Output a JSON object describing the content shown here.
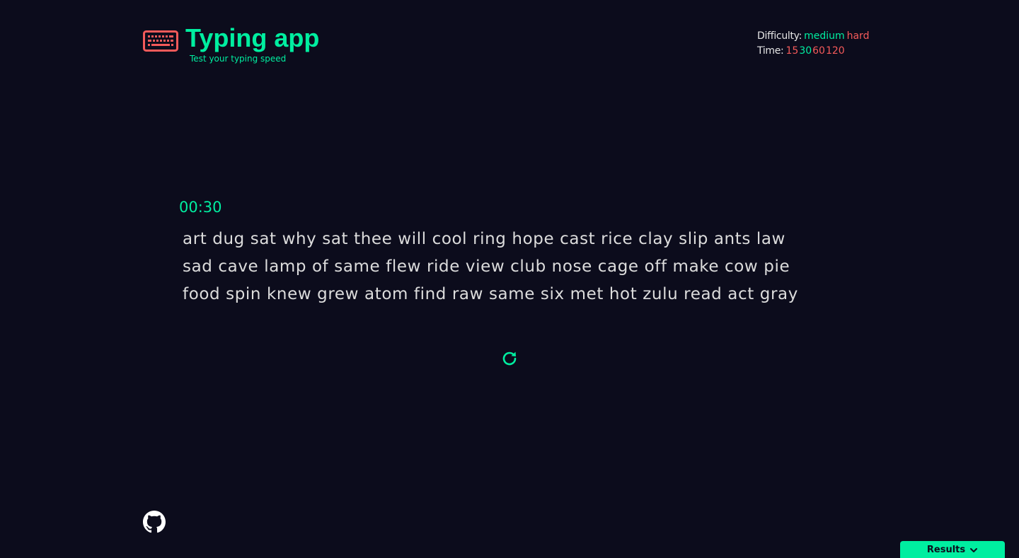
{
  "header": {
    "title": "Typing app",
    "tagline": "Test your typing speed",
    "logo_icon": "keyboard-icon"
  },
  "settings": {
    "difficulty_label": "Difficulty:",
    "difficulty_options": [
      {
        "label": "medium",
        "active": true
      },
      {
        "label": "hard",
        "active": false
      }
    ],
    "time_label": "Time:",
    "time_options": [
      {
        "label": "15",
        "active": false
      },
      {
        "label": "30",
        "active": true
      },
      {
        "label": "60",
        "active": false
      },
      {
        "label": "120",
        "active": false
      }
    ]
  },
  "test": {
    "timer": "00:30",
    "lines": [
      "art dug sat why sat thee will cool ring hope cast rice clay slip ants law",
      "sad cave lamp of same flew ride view club nose cage off make cow pie",
      "food spin knew grew atom find raw same six met hot zulu read act gray"
    ],
    "refresh_icon": "refresh-icon"
  },
  "footer": {
    "github_icon": "github-icon",
    "results_label": "Results",
    "results_icon": "chevron-down-icon"
  },
  "colors": {
    "background": "#0c0c1c",
    "accent": "#00eea0",
    "inactive_option": "#f55a5a",
    "text": "#dcdcdc",
    "logo": "#f55a5a"
  }
}
